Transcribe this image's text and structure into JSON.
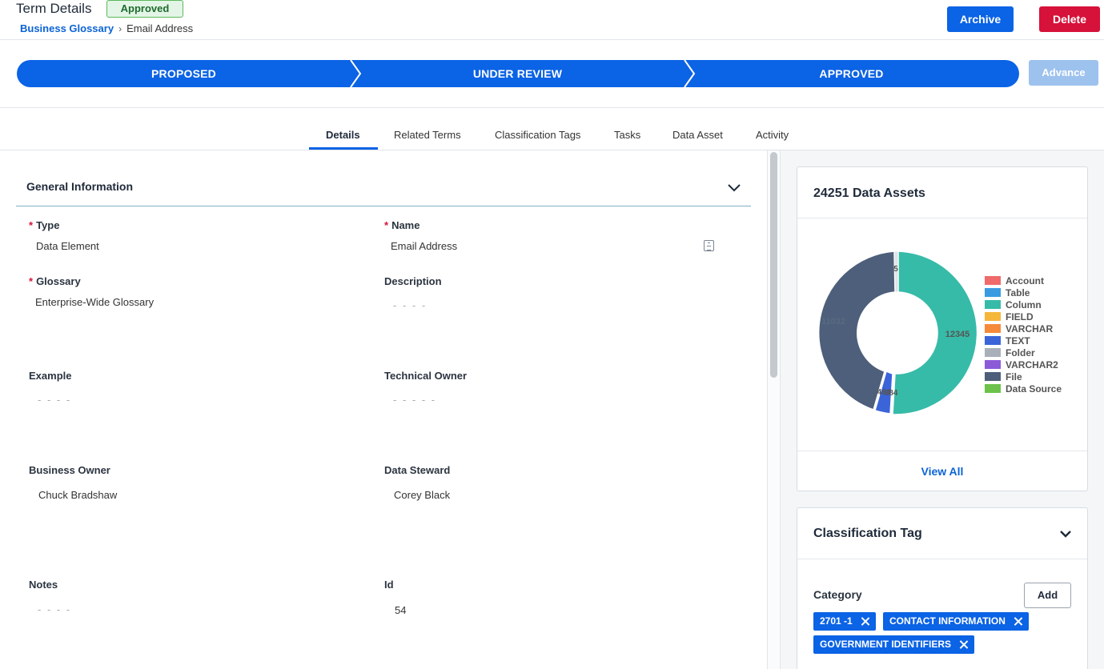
{
  "header": {
    "title": "Term Details",
    "status_badge": "Approved",
    "breadcrumb": {
      "parent": "Business Glossary",
      "current": "Email Address"
    },
    "archive_label": "Archive",
    "delete_label": "Delete"
  },
  "workflow": {
    "stages": [
      "PROPOSED",
      "UNDER REVIEW",
      "APPROVED"
    ],
    "advance_label": "Advance",
    "stage_color": "#0b63e5",
    "advance_disabled": true
  },
  "tabs": [
    "Details",
    "Related Terms",
    "Classification Tags",
    "Tasks",
    "Data Asset",
    "Activity"
  ],
  "active_tab": "Details",
  "general": {
    "title": "General Information",
    "type_label": "Type",
    "type_value": "Data Element",
    "name_label": "Name",
    "name_value": "Email Address",
    "glossary_label": "Glossary",
    "glossary_value": "Enterprise-Wide Glossary",
    "description_label": "Description",
    "description_value": "- - - -",
    "example_label": "Example",
    "example_value": "- - - -",
    "tech_owner_label": "Technical Owner",
    "tech_owner_value": "- - - - -",
    "business_owner_label": "Business Owner",
    "business_owner_value": "Chuck Bradshaw",
    "steward_label": "Data Steward",
    "steward_value": "Corey Black",
    "notes_label": "Notes",
    "notes_value": "- - - -",
    "id_label": "Id",
    "id_value": "54"
  },
  "assets_card": {
    "title": "24251 Data Assets",
    "view_all": "View All",
    "legend": [
      {
        "name": "Account",
        "color": "#ef6b6b"
      },
      {
        "name": "Table",
        "color": "#3a9be0"
      },
      {
        "name": "Column",
        "color": "#36bba8"
      },
      {
        "name": "FIELD",
        "color": "#f5b73a"
      },
      {
        "name": "VARCHAR",
        "color": "#f58a3a"
      },
      {
        "name": "TEXT",
        "color": "#3b64d9"
      },
      {
        "name": "Folder",
        "color": "#a9b0ba"
      },
      {
        "name": "VARCHAR2",
        "color": "#8c5bd8"
      },
      {
        "name": "File",
        "color": "#4d5f7a"
      },
      {
        "name": "Data Source",
        "color": "#6cc24a"
      }
    ],
    "slice_labels": {
      "column": "12345",
      "file": "11032",
      "small_a": "5",
      "small_b": "464",
      "small_c": "384"
    }
  },
  "tags_card": {
    "title": "Classification Tag",
    "category_label": "Category",
    "add_label": "Add",
    "tags": [
      "2701 -1",
      "CONTACT INFORMATION",
      "GOVERNMENT IDENTIFIERS"
    ]
  }
}
